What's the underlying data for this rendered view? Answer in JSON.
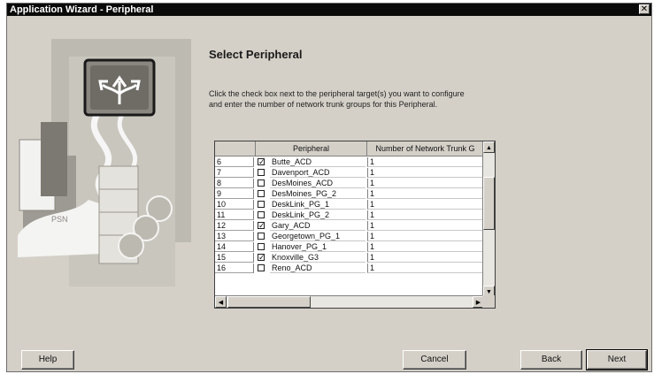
{
  "window": {
    "title": "Application Wizard - Peripheral",
    "close_glyph": "✕"
  },
  "page": {
    "heading": "Select Peripheral",
    "instructions_line1": "Click the check box next to the peripheral target(s) you want to configure",
    "instructions_line2": "and  enter the number of network trunk groups for this Peripheral."
  },
  "grid": {
    "headers": [
      "Peripheral",
      "Number of Network Trunk G"
    ],
    "rows": [
      {
        "num": "6",
        "checked": true,
        "checkmark": "✓",
        "name": "Butte_ACD",
        "trunks": "1"
      },
      {
        "num": "7",
        "checked": false,
        "checkmark": "",
        "name": "Davenport_ACD",
        "trunks": "1"
      },
      {
        "num": "8",
        "checked": false,
        "checkmark": "",
        "name": "DesMoines_ACD",
        "trunks": "1"
      },
      {
        "num": "9",
        "checked": false,
        "checkmark": "",
        "name": "DesMoines_PG_2",
        "trunks": "1"
      },
      {
        "num": "10",
        "checked": false,
        "checkmark": "",
        "name": "DeskLink_PG_1",
        "trunks": "1"
      },
      {
        "num": "11",
        "checked": false,
        "checkmark": "",
        "name": "DeskLink_PG_2",
        "trunks": "1"
      },
      {
        "num": "12",
        "checked": true,
        "checkmark": "✓",
        "name": "Gary_ACD",
        "trunks": "1"
      },
      {
        "num": "13",
        "checked": false,
        "checkmark": "",
        "name": "Georgetown_PG_1",
        "trunks": "1"
      },
      {
        "num": "14",
        "checked": false,
        "checkmark": "",
        "name": "Hanover_PG_1",
        "trunks": "1"
      },
      {
        "num": "15",
        "checked": true,
        "checkmark": "✓",
        "name": "Knoxville_G3",
        "trunks": "1"
      },
      {
        "num": "16",
        "checked": false,
        "checkmark": "",
        "name": "Reno_ACD",
        "trunks": "1"
      }
    ],
    "scroll_up": "▲",
    "scroll_down": "▼",
    "scroll_left": "◀",
    "scroll_right": "▶"
  },
  "buttons": {
    "help": "Help",
    "cancel": "Cancel",
    "back": "Back",
    "next": "Next"
  },
  "illustration": {
    "label": "PSN",
    "icon": "routing-arrows-icon"
  }
}
